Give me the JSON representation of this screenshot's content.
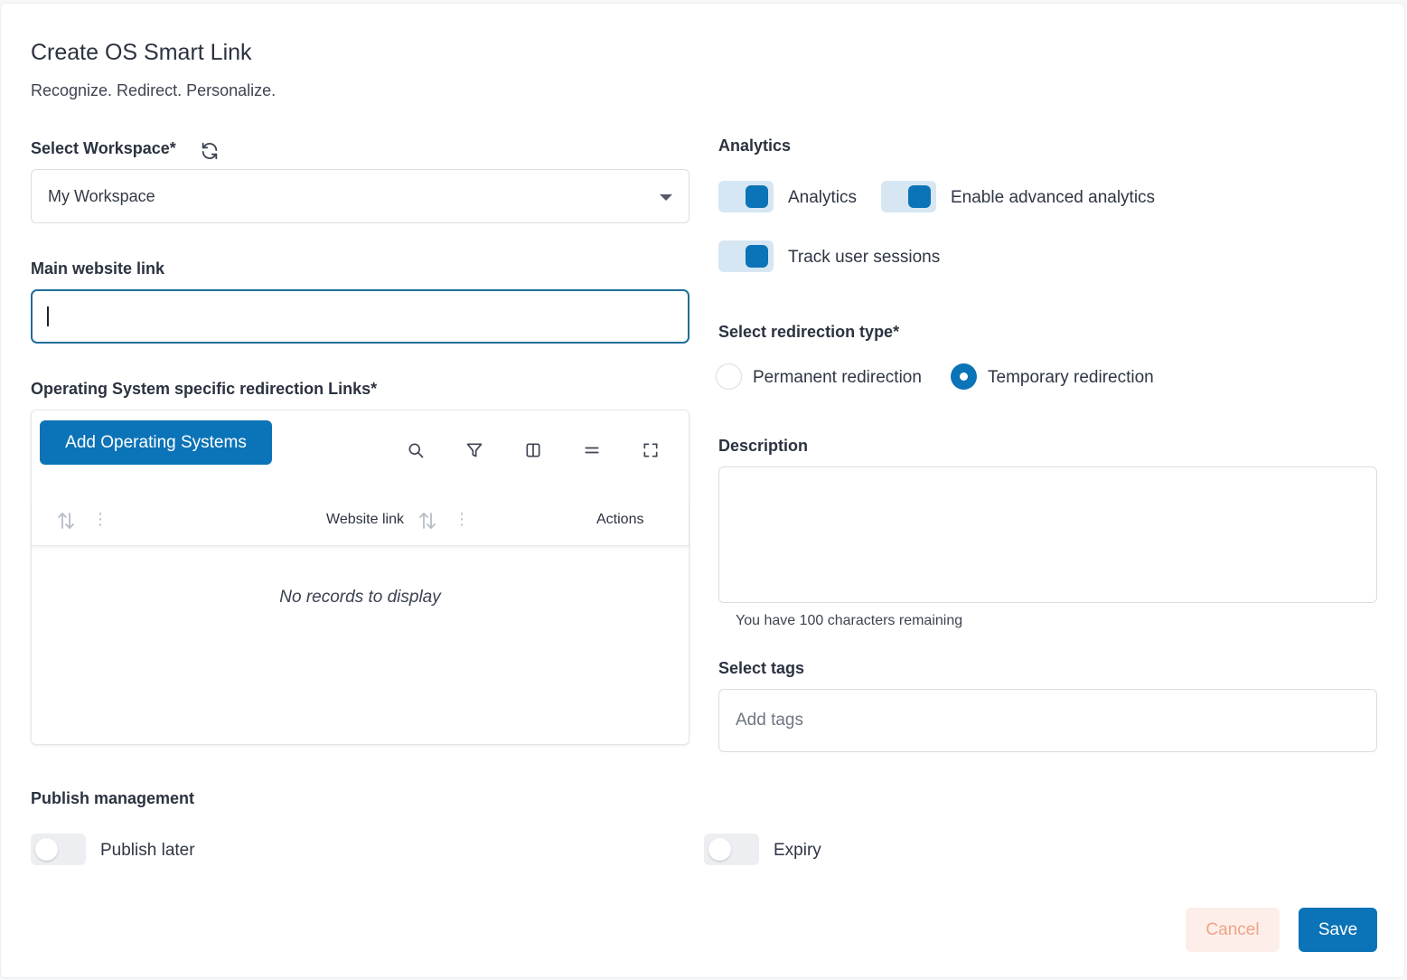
{
  "header": {
    "title": "Create OS Smart Link",
    "subtitle": "Recognize. Redirect. Personalize."
  },
  "workspace": {
    "label": "Select Workspace*",
    "selected": "My Workspace"
  },
  "main_link": {
    "label": "Main website link",
    "value": ""
  },
  "os_links": {
    "label": "Operating System specific redirection Links*",
    "add_button": "Add Operating Systems",
    "columns": [
      "Website link",
      "Actions"
    ],
    "empty_text": "No records to display"
  },
  "analytics": {
    "label": "Analytics",
    "toggles": [
      {
        "label": "Analytics",
        "on": true
      },
      {
        "label": "Enable advanced analytics",
        "on": true
      },
      {
        "label": "Track user sessions",
        "on": true
      }
    ]
  },
  "redirection": {
    "label": "Select redirection type*",
    "options": [
      {
        "label": "Permanent redirection",
        "selected": false
      },
      {
        "label": "Temporary redirection",
        "selected": true
      }
    ]
  },
  "description": {
    "label": "Description",
    "value": "",
    "helper": "You have 100 characters remaining"
  },
  "tags": {
    "label": "Select tags",
    "placeholder": "Add tags"
  },
  "publish": {
    "label": "Publish management",
    "toggles": [
      {
        "label": "Publish later",
        "on": false
      },
      {
        "label": "Expiry",
        "on": false
      }
    ]
  },
  "footer": {
    "cancel": "Cancel",
    "save": "Save"
  },
  "colors": {
    "primary": "#0b73b7",
    "toggle_track": "#d6e6f3",
    "cancel_bg": "#fdeee9",
    "cancel_text": "#eea489"
  }
}
